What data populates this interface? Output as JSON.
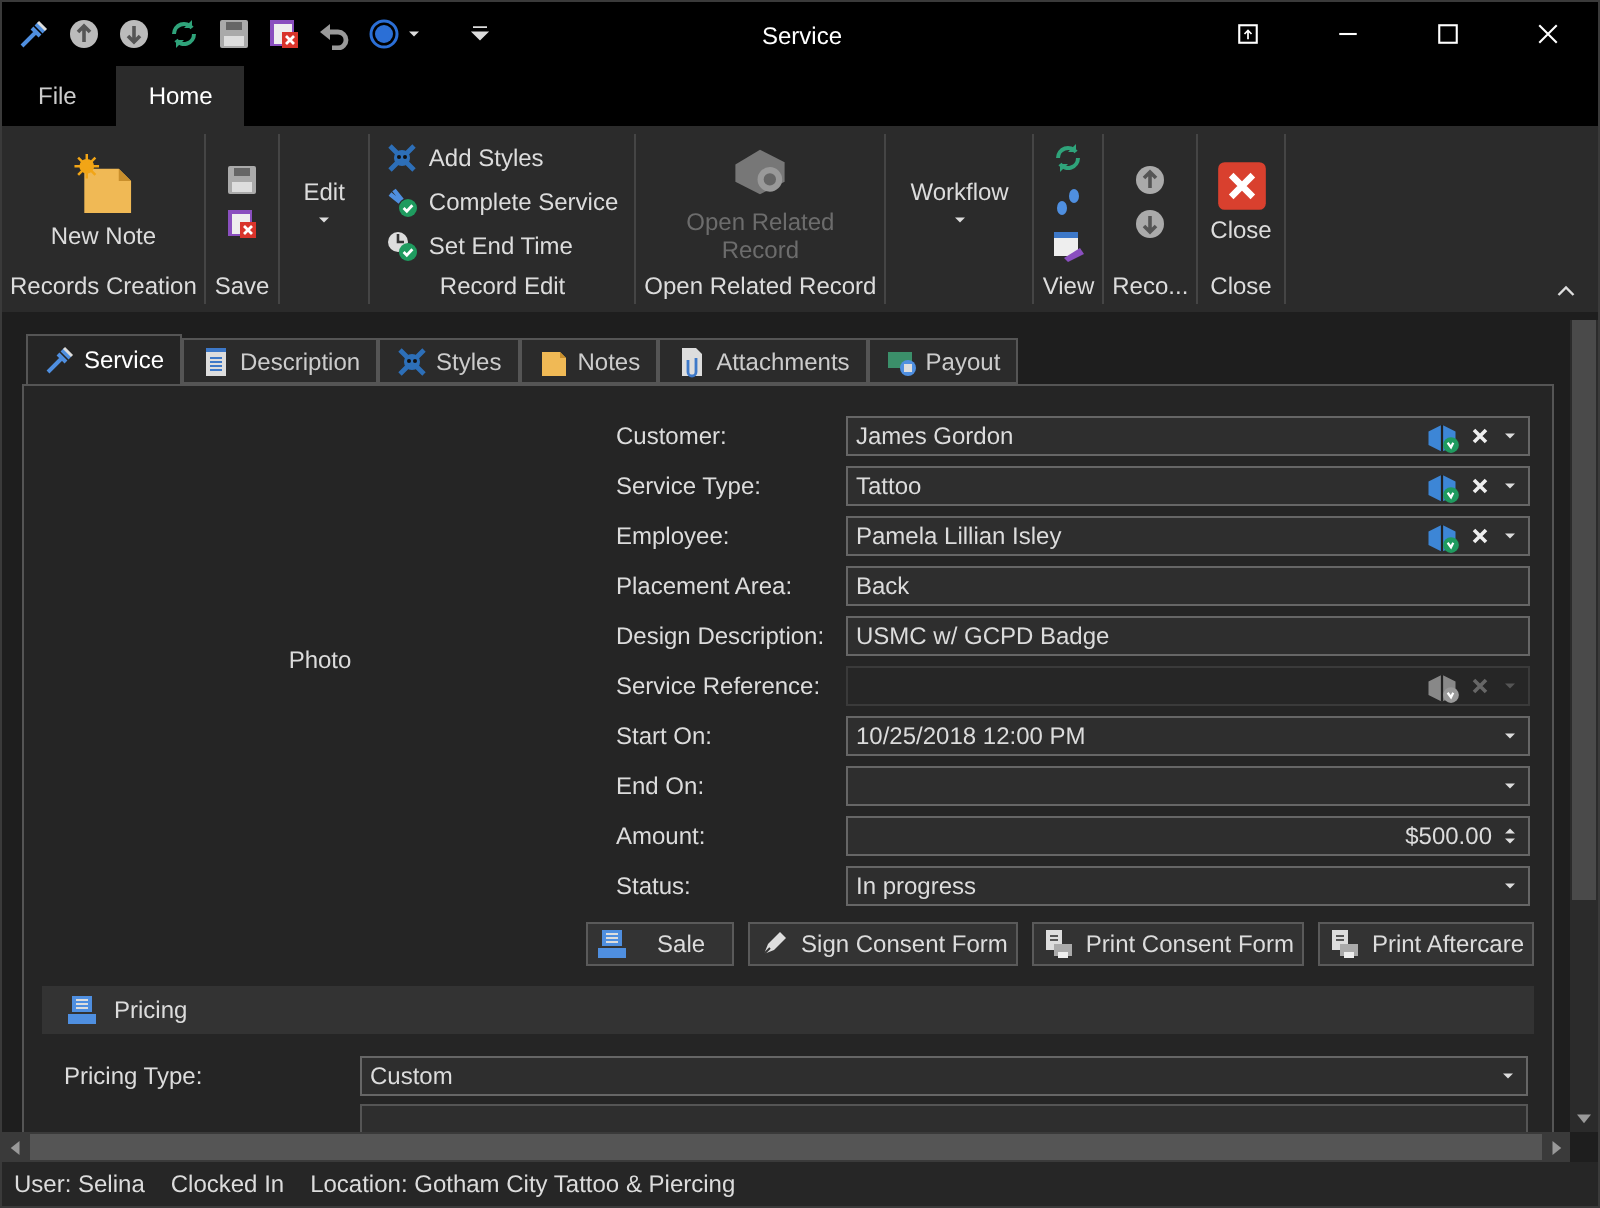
{
  "window": {
    "title": "Service"
  },
  "ribbon": {
    "tabs": [
      {
        "label": "File",
        "selected": false
      },
      {
        "label": "Home",
        "selected": true
      }
    ],
    "groups": [
      {
        "kind": "large",
        "label": "Records Creation",
        "buttons": [
          {
            "label": "New Note",
            "disabled": false
          }
        ]
      },
      {
        "kind": "icon_stack",
        "label": "Save"
      },
      {
        "kind": "menu",
        "buttons": [
          {
            "label": "Edit"
          }
        ]
      },
      {
        "kind": "list",
        "label": "Record Edit",
        "buttons": [
          {
            "label": "Add Styles"
          },
          {
            "label": "Complete Service"
          },
          {
            "label": "Set End Time"
          }
        ]
      },
      {
        "kind": "large",
        "label": "Open Related Record",
        "buttons": [
          {
            "label": "Open Related Record",
            "disabled": true
          }
        ]
      },
      {
        "kind": "menu",
        "buttons": [
          {
            "label": "Workflow"
          }
        ]
      },
      {
        "kind": "icon_stack",
        "label": "View"
      },
      {
        "kind": "icon_stack",
        "label": "Reco..."
      },
      {
        "kind": "large",
        "label": "Close",
        "buttons": [
          {
            "label": "Close",
            "disabled": false
          }
        ]
      }
    ]
  },
  "tabs": [
    {
      "label": "Service",
      "selected": true
    },
    {
      "label": "Description",
      "selected": false
    },
    {
      "label": "Styles",
      "selected": false
    },
    {
      "label": "Notes",
      "selected": false
    },
    {
      "label": "Attachments",
      "selected": false
    },
    {
      "label": "Payout",
      "selected": false
    }
  ],
  "photo": {
    "label": "Photo"
  },
  "fields": [
    {
      "kind": "lookup",
      "label": "Customer:",
      "value": "James Gordon",
      "disabled": false
    },
    {
      "kind": "lookup",
      "label": "Service Type:",
      "value": "Tattoo",
      "disabled": false
    },
    {
      "kind": "lookup",
      "label": "Employee:",
      "value": "Pamela Lillian Isley",
      "disabled": false
    },
    {
      "kind": "text",
      "label": "Placement Area:",
      "value": "Back"
    },
    {
      "kind": "text",
      "label": "Design Description:",
      "value": "USMC w/ GCPD Badge"
    },
    {
      "kind": "lookup",
      "label": "Service Reference:",
      "disabled": true
    },
    {
      "kind": "date",
      "label": "Start On:",
      "value": "10/25/2018 12:00 PM"
    },
    {
      "kind": "date",
      "label": "End On:"
    },
    {
      "kind": "money",
      "label": "Amount:",
      "value": "$500.00"
    },
    {
      "kind": "combo",
      "label": "Status:",
      "value": "In progress"
    }
  ],
  "actions": [
    "Sale",
    "Sign Consent Form",
    "Print Consent Form",
    "Print Aftercare"
  ],
  "pricing": {
    "title": "Pricing",
    "fields": [
      {
        "kind": "combo",
        "label": "Pricing Type:",
        "value": "Custom"
      }
    ]
  },
  "status_bar": [
    "User: Selina",
    "Clocked In",
    "Location: Gotham City Tattoo & Piercing"
  ]
}
